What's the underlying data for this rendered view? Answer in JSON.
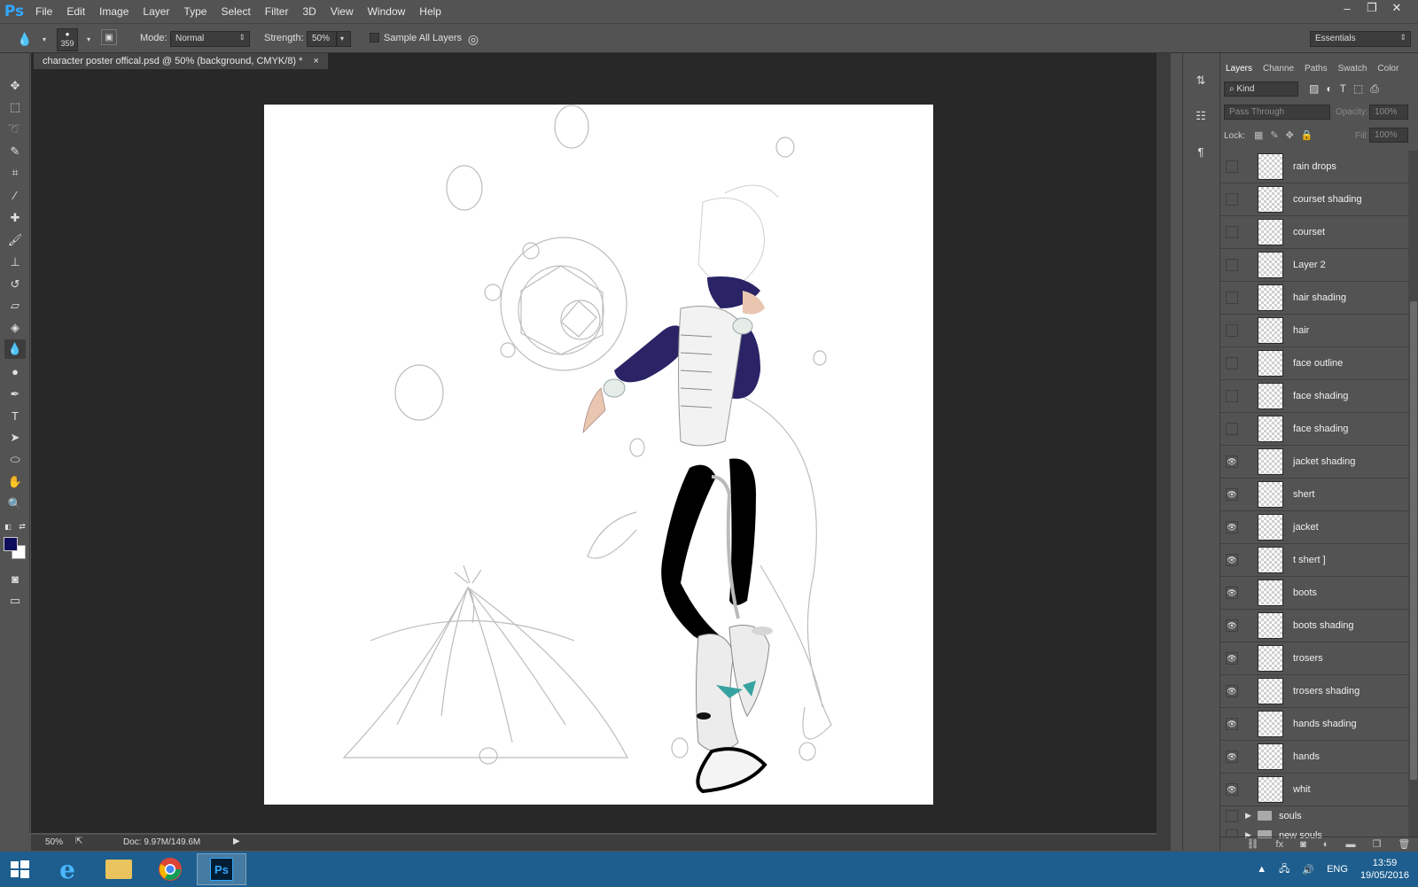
{
  "menubar": {
    "logo": "Ps",
    "items": [
      "File",
      "Edit",
      "Image",
      "Layer",
      "Type",
      "Select",
      "Filter",
      "3D",
      "View",
      "Window",
      "Help"
    ],
    "win_min": "‒",
    "win_max": "❐",
    "win_close": "✕"
  },
  "options": {
    "brush_size": "359",
    "mode_label": "Mode:",
    "mode_value": "Normal",
    "strength_label": "Strength:",
    "strength_value": "50%",
    "sample_all_layers": "Sample All Layers",
    "workspace": "Essentials"
  },
  "document": {
    "tab_title": "character poster offical.psd @ 50% (background, CMYK/8) *",
    "tab_close": "×",
    "zoom": "50%",
    "doc_size": "Doc: 9.97M/149.6M"
  },
  "colors": {
    "foreground": "#0d0d5c",
    "background": "#ffffff",
    "jacket": "#2a2466",
    "taskbar": "#1d5e8e",
    "ps_blue": "#31a8ff"
  },
  "layers_panel": {
    "tabs": [
      "Layers",
      "Channe",
      "Paths",
      "Swatch",
      "Color"
    ],
    "filter_kind": "Kind",
    "blend_mode": "Pass Through",
    "opacity_label": "Opacity:",
    "opacity_value": "100%",
    "lock_label": "Lock:",
    "fill_label": "Fill:",
    "fill_value": "100%",
    "layers": [
      {
        "name": "rain drops",
        "visible": false
      },
      {
        "name": "courset shading",
        "visible": false
      },
      {
        "name": "courset",
        "visible": false
      },
      {
        "name": "Layer 2",
        "visible": false
      },
      {
        "name": "hair shading",
        "visible": false
      },
      {
        "name": "hair",
        "visible": false
      },
      {
        "name": "face outline",
        "visible": false
      },
      {
        "name": "face shading",
        "visible": false
      },
      {
        "name": "face shading",
        "visible": false
      },
      {
        "name": "jacket shading",
        "visible": true
      },
      {
        "name": "shert",
        "visible": true
      },
      {
        "name": "jacket",
        "visible": true
      },
      {
        "name": "t shert ]",
        "visible": true
      },
      {
        "name": "boots",
        "visible": true
      },
      {
        "name": "boots shading",
        "visible": true
      },
      {
        "name": "trosers",
        "visible": true
      },
      {
        "name": "trosers shading",
        "visible": true
      },
      {
        "name": "hands shading",
        "visible": true
      },
      {
        "name": "hands",
        "visible": true
      },
      {
        "name": "whit",
        "visible": true
      }
    ],
    "groups": [
      {
        "name": "souls"
      },
      {
        "name": "new souls"
      }
    ],
    "eye_glyph": "👁"
  },
  "taskbar": {
    "language": "ENG",
    "time": "13:59",
    "date": "19/05/2016",
    "ps_label": "Ps"
  },
  "icons": {
    "tools": [
      "move-icon",
      "marquee-icon",
      "lasso-icon",
      "quick-select-icon",
      "crop-icon",
      "eyedropper-icon",
      "healing-icon",
      "brush-icon",
      "stamp-icon",
      "history-brush-icon",
      "eraser-icon",
      "paint-bucket-icon",
      "blur-icon",
      "dodge-icon",
      "pen-icon",
      "type-icon",
      "path-select-icon",
      "ellipse-icon",
      "hand-icon",
      "zoom-icon"
    ]
  }
}
